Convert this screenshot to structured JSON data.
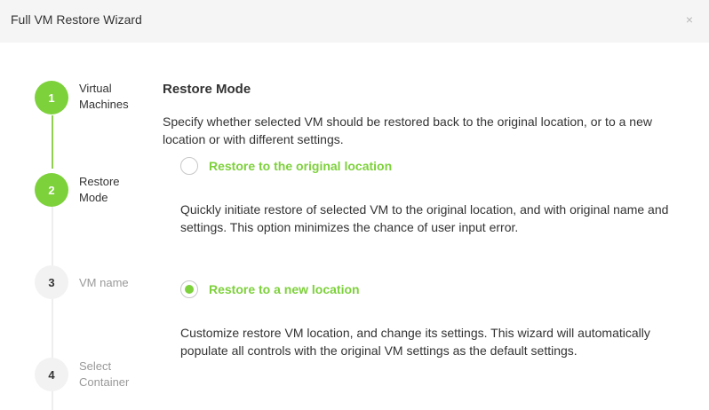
{
  "dialog": {
    "title": "Full VM Restore Wizard",
    "close_icon": "×"
  },
  "steps": [
    {
      "number": "1",
      "label": "Virtual Machines",
      "state": "completed"
    },
    {
      "number": "2",
      "label": "Restore Mode",
      "state": "current"
    },
    {
      "number": "3",
      "label": "VM name",
      "state": "pending"
    },
    {
      "number": "4",
      "label": "Select Container",
      "state": "pending"
    }
  ],
  "main": {
    "heading": "Restore Mode",
    "description": "Specify whether selected VM should be restored back to the original location, or to a new location or with different settings.",
    "options": [
      {
        "label": "Restore to the original location",
        "description": "Quickly initiate restore of selected VM to the original location, and with original name and settings. This option minimizes the chance of user input error.",
        "selected": false
      },
      {
        "label": "Restore to a new location",
        "description": "Customize restore VM location, and change its settings. This wizard will automatically populate all controls with the original VM settings as the default settings.",
        "selected": true
      }
    ]
  },
  "colors": {
    "accent": "#7dd13b",
    "titlebar": "#f5f5f5",
    "inactive_text": "#999999"
  }
}
